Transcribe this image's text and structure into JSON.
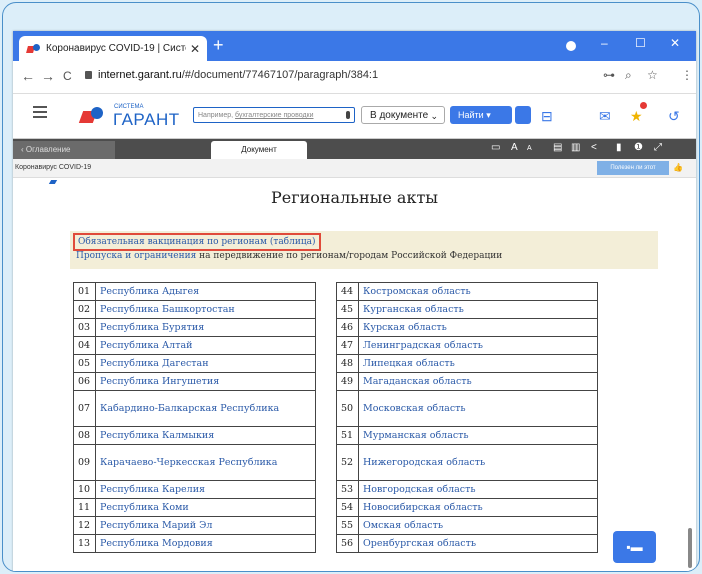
{
  "browser": {
    "tab_title": "Коронавирус COVID-19 | Систе",
    "tab_close": "✕",
    "new_tab": "+",
    "url_host": "internet.garant.ru",
    "url_path": "/#/document/77467107/paragraph/384:1",
    "back": "←",
    "forward": "→",
    "reload": "C",
    "key_icon": "⊶",
    "zoom_icon": "⌕",
    "star_icon": "☆",
    "menu_icon": "⋮",
    "win_min": "–",
    "win_max": "☐",
    "win_close": "✕"
  },
  "app": {
    "logo_small": "СИСТЕМА",
    "logo": "ГАРАНТ",
    "search_placeholder_a": "Например, ",
    "search_placeholder_b": "бухгалтерские проводки",
    "scope": "В документе",
    "find_button": "Найти"
  },
  "toolbar": {
    "toc_tab": "Оглавление",
    "doc_tab": "Документ",
    "font_label": "A",
    "font_small": "A"
  },
  "breadcrumb": {
    "path": "Коронавирус COVID-19",
    "useful": "Полезен ли этот документ?"
  },
  "document": {
    "title": "Региональные акты",
    "notice_line1_link": "Обязательная вакцинация по регионам (таблица)",
    "notice_line2_link": "Пропуска и ограничения",
    "notice_line2_rest": " на передвижение по регионам/городам Российской Федерации"
  },
  "table_left": [
    {
      "num": "01",
      "name": "Республика Адыгея"
    },
    {
      "num": "02",
      "name": "Республика Башкортостан"
    },
    {
      "num": "03",
      "name": "Республика Бурятия"
    },
    {
      "num": "04",
      "name": "Республика Алтай"
    },
    {
      "num": "05",
      "name": "Республика Дагестан"
    },
    {
      "num": "06",
      "name": "Республика Ингушетия"
    },
    {
      "num": "07",
      "name": "Кабардино-Балкарская Республика"
    },
    {
      "num": "08",
      "name": "Республика Калмыкия"
    },
    {
      "num": "09",
      "name": "Карачаево-Черкесская Республика"
    },
    {
      "num": "10",
      "name": "Республика Карелия"
    },
    {
      "num": "11",
      "name": "Республика Коми"
    },
    {
      "num": "12",
      "name": "Республика Марий Эл"
    },
    {
      "num": "13",
      "name": "Республика Мордовия"
    }
  ],
  "table_right": [
    {
      "num": "44",
      "name": "Костромская область"
    },
    {
      "num": "45",
      "name": "Курганская область"
    },
    {
      "num": "46",
      "name": "Курская область"
    },
    {
      "num": "47",
      "name": "Ленинградская область"
    },
    {
      "num": "48",
      "name": "Липецкая область"
    },
    {
      "num": "49",
      "name": "Магаданская область"
    },
    {
      "num": "50",
      "name": "Московская область"
    },
    {
      "num": "51",
      "name": "Мурманская область"
    },
    {
      "num": "52",
      "name": "Нижегородская область"
    },
    {
      "num": "53",
      "name": "Новгородская область"
    },
    {
      "num": "54",
      "name": "Новосибирская область"
    },
    {
      "num": "55",
      "name": "Омская область"
    },
    {
      "num": "56",
      "name": "Оренбургская область"
    }
  ],
  "tall_rows": [
    6,
    8
  ],
  "colors": {
    "browser_blue": "#3b78e7",
    "garant_blue": "#1e63c6",
    "garant_red": "#e53935",
    "link": "#2b5aa8",
    "notice_bg": "#f3eed8",
    "highlight_border": "#e04a3a"
  }
}
